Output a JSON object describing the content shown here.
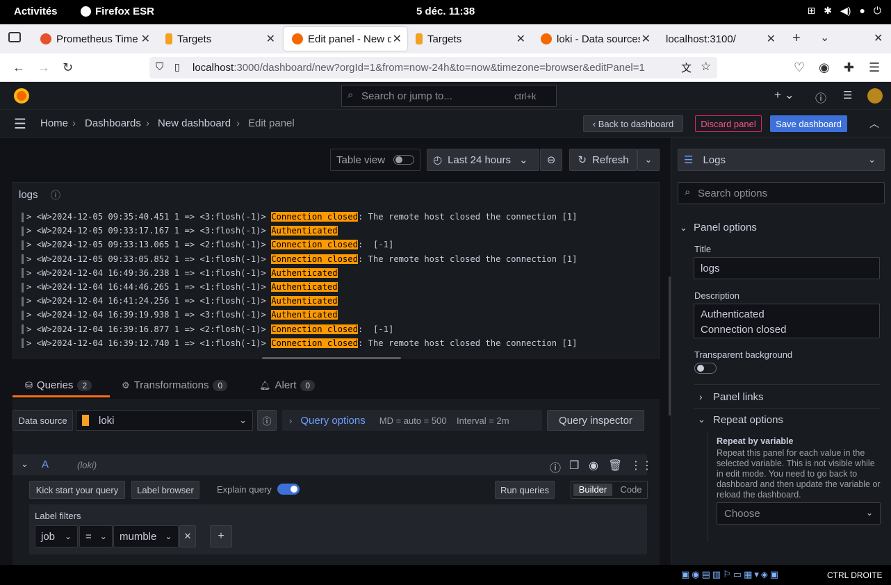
{
  "os": {
    "activities": "Activités",
    "app": "Firefox ESR",
    "clock": "5 déc.  11:38"
  },
  "browser": {
    "tabs": [
      {
        "title": "Prometheus Time ",
        "color": "#e6522c"
      },
      {
        "title": "Targets",
        "color": "#f4a020"
      },
      {
        "title": "Edit panel - New d",
        "color": "#f46800"
      },
      {
        "title": "Targets",
        "color": "#f4a020"
      },
      {
        "title": "loki - Data sources",
        "color": "#f46800"
      },
      {
        "title": "localhost:3100/",
        "color": ""
      }
    ],
    "url_host": "localhost",
    "url_rest": ":3000/dashboard/new?orgId=1&from=now-24h&to=now&timezone=browser&editPanel=1"
  },
  "grafana": {
    "search_placeholder": "Search or jump to...",
    "search_shortcut": "ctrl+k",
    "breadcrumb": [
      "Home",
      "Dashboards",
      "New dashboard",
      "Edit panel"
    ],
    "back_label": "Back to dashboard",
    "discard_label": "Discard panel",
    "save_label": "Save dashboard",
    "table_view": "Table view",
    "time_range": "Last 24 hours",
    "refresh": "Refresh",
    "panel_title": "logs",
    "logs": [
      {
        "pre": "> <W>2024-12-05 09:35:40.451 1 => <3:flosh(-1)> ",
        "hl": "Connection closed",
        "post": ": The remote host closed the connection [1]"
      },
      {
        "pre": "> <W>2024-12-05 09:33:17.167 1 => <3:flosh(-1)> ",
        "hl": "Authenticated",
        "post": ""
      },
      {
        "pre": "> <W>2024-12-05 09:33:13.065 1 => <2:flosh(-1)> ",
        "hl": "Connection closed",
        "post": ":  [-1]"
      },
      {
        "pre": "> <W>2024-12-05 09:33:05.852 1 => <1:flosh(-1)> ",
        "hl": "Connection closed",
        "post": ": The remote host closed the connection [1]"
      },
      {
        "pre": "> <W>2024-12-04 16:49:36.238 1 => <1:flosh(-1)> ",
        "hl": "Authenticated",
        "post": ""
      },
      {
        "pre": "> <W>2024-12-04 16:44:46.265 1 => <1:flosh(-1)> ",
        "hl": "Authenticated",
        "post": ""
      },
      {
        "pre": "> <W>2024-12-04 16:41:24.256 1 => <1:flosh(-1)> ",
        "hl": "Authenticated",
        "post": ""
      },
      {
        "pre": "> <W>2024-12-04 16:39:19.938 1 => <3:flosh(-1)> ",
        "hl": "Authenticated",
        "post": ""
      },
      {
        "pre": "> <W>2024-12-04 16:39:16.877 1 => <2:flosh(-1)> ",
        "hl": "Connection closed",
        "post": ":  [-1]"
      },
      {
        "pre": "> <W>2024-12-04 16:39:12.740 1 => <1:flosh(-1)> ",
        "hl": "Connection closed",
        "post": ": The remote host closed the connection [1]"
      }
    ],
    "tabs": {
      "queries": "Queries",
      "queries_count": "2",
      "transformations": "Transformations",
      "transformations_count": "0",
      "alert": "Alert",
      "alert_count": "0"
    },
    "datasource_label": "Data source",
    "datasource": "loki",
    "query_options": "Query options",
    "query_meta": "MD = auto = 500    Interval = 2m",
    "query_inspector": "Query inspector",
    "query": {
      "ref": "A",
      "ds": "(loki)",
      "kick": "Kick start your query",
      "label_browser": "Label browser",
      "explain": "Explain query",
      "run": "Run queries",
      "builder": "Builder",
      "code": "Code",
      "label_filters": "Label filters",
      "filter_key": "job",
      "filter_op": "=",
      "filter_value": "mumble"
    },
    "side": {
      "viz": "Logs",
      "search_placeholder": "Search options",
      "panel_options": "Panel options",
      "title_label": "Title",
      "title_value": "logs",
      "desc_label": "Description",
      "desc_line1": "Authenticated",
      "desc_line2": "Connection closed",
      "transparent": "Transparent background",
      "panel_links": "Panel links",
      "repeat_options": "Repeat options",
      "repeat_by": "Repeat by variable",
      "repeat_help": "Repeat this panel for each value in the selected variable. This is not visible while in edit mode. You need to go back to dashboard and then update the variable or reload the dashboard.",
      "choose": "Choose"
    }
  },
  "taskbar": {
    "label": "CTRL DROITE"
  }
}
